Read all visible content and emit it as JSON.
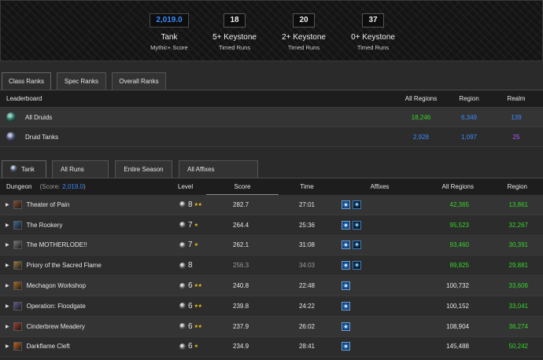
{
  "stats": [
    {
      "value": "2,019.0",
      "label": "Tank",
      "sub": "Mythic+ Score"
    },
    {
      "value": "18",
      "label": "5+ Keystone",
      "sub": "Timed Runs"
    },
    {
      "value": "20",
      "label": "2+ Keystone",
      "sub": "Timed Runs"
    },
    {
      "value": "37",
      "label": "0+ Keystone",
      "sub": "Timed Runs"
    }
  ],
  "rank_tabs": [
    "Class Ranks",
    "Spec Ranks",
    "Overall Ranks"
  ],
  "leaderboard": {
    "headers": {
      "name": "Leaderboard",
      "all": "All Regions",
      "region": "Region",
      "realm": "Realm"
    },
    "rows": [
      {
        "name": "All Druids",
        "all": "18,246",
        "region": "6,349",
        "realm": "139"
      },
      {
        "name": "Druid Tanks",
        "all": "2,928",
        "region": "1,097",
        "realm": "25"
      }
    ]
  },
  "run_tabs": [
    "Tank",
    "All Runs",
    "Entire Season",
    "All Affixes"
  ],
  "dungeons": {
    "headers": {
      "dungeon": "Dungeon",
      "score_prefix": "(Score:",
      "score_value": "2,019.0",
      "score_suffix": ")",
      "level": "Level",
      "score": "Score",
      "time": "Time",
      "affixes": "Affixes",
      "all": "All Regions",
      "region": "Region"
    },
    "rows": [
      {
        "name": "Theater of Pain",
        "level": "8",
        "stars": "★★",
        "score": "282.7",
        "time": "27:01",
        "affixes": 2,
        "all": "42,365",
        "region": "13,861",
        "timed": true,
        "icon_color": "#8a4a2a"
      },
      {
        "name": "The Rookery",
        "level": "7",
        "stars": "★",
        "score": "264.4",
        "time": "25:36",
        "affixes": 2,
        "all": "95,523",
        "region": "32,267",
        "timed": true,
        "icon_color": "#3a6a9a"
      },
      {
        "name": "The MOTHERLODE!!",
        "level": "7",
        "stars": "★",
        "score": "262.1",
        "time": "31:08",
        "affixes": 2,
        "all": "93,460",
        "region": "30,391",
        "timed": true,
        "icon_color": "#7a7a7a"
      },
      {
        "name": "Priory of the Sacred Flame",
        "level": "8",
        "stars": "",
        "score": "256.3",
        "time": "34:03",
        "affixes": 2,
        "all": "89,825",
        "region": "29,881",
        "timed": false,
        "icon_color": "#9a7a3a"
      },
      {
        "name": "Mechagon Workshop",
        "level": "6",
        "stars": "★★",
        "score": "240.8",
        "time": "22:48",
        "affixes": 1,
        "all": "100,732",
        "region": "33,606",
        "timed": true,
        "icon_color": "#b06a20"
      },
      {
        "name": "Operation: Floodgate",
        "level": "6",
        "stars": "★★",
        "score": "239.8",
        "time": "24:22",
        "affixes": 1,
        "all": "100,152",
        "region": "33,041",
        "timed": true,
        "icon_color": "#5a5a8a"
      },
      {
        "name": "Cinderbrew Meadery",
        "level": "6",
        "stars": "★★",
        "score": "237.9",
        "time": "26:02",
        "affixes": 1,
        "all": "108,904",
        "region": "36,274",
        "timed": true,
        "icon_color": "#a03a2a"
      },
      {
        "name": "Darkflame Cleft",
        "level": "6",
        "stars": "★",
        "score": "234.9",
        "time": "28:41",
        "affixes": 1,
        "all": "145,488",
        "region": "50,242",
        "timed": true,
        "icon_color": "#c0601a"
      }
    ]
  }
}
